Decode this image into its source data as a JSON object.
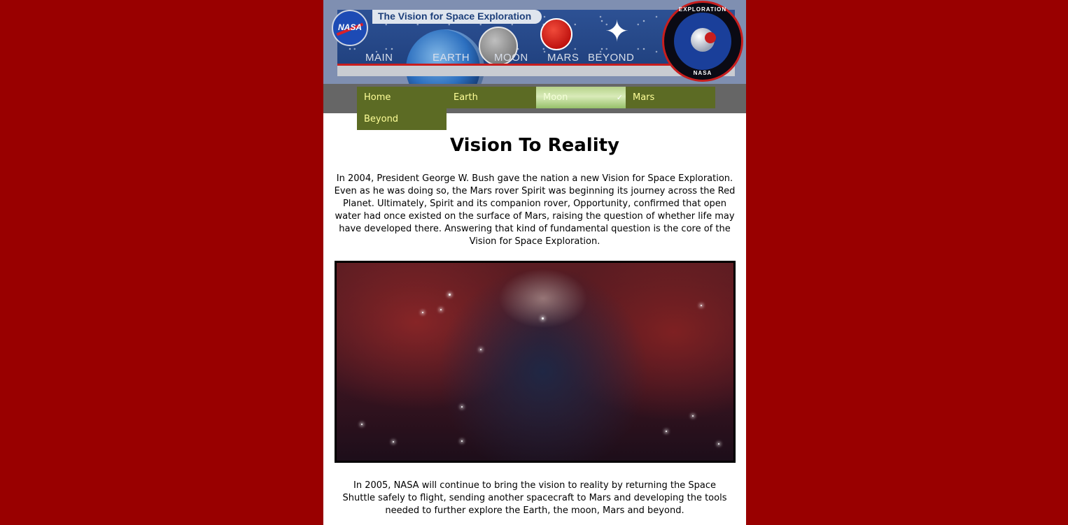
{
  "banner": {
    "title": "The Vision for Space Exploration",
    "logo_text": "NASA",
    "nav": [
      "MAIN",
      "EARTH",
      "MOON",
      "MARS",
      "BEYOND"
    ],
    "seal_top": "EXPLORATION",
    "seal_bottom": "NASA"
  },
  "nav": {
    "home": "Home",
    "earth": "Earth",
    "moon": "Moon",
    "mars": "Mars",
    "beyond": "Beyond"
  },
  "content": {
    "title": "Vision To Reality",
    "para_1": "In 2004, President George W. Bush gave the nation a new Vision for Space Exploration. Even as he was doing so, the Mars rover Spirit was beginning its journey across the Red Planet. Ultimately, Spirit and its companion rover, Opportunity, confirmed that open water had once existed on the surface of Mars, raising the question of whether life may have developed there. Answering that kind of fundamental question is the core of the Vision for Space Exploration.",
    "para_2": "In 2005, NASA will continue to bring the vision to reality by returning the Space Shuttle safely to flight, sending another spacecraft to Mars and developing the tools needed to further explore the Earth, the moon, Mars and beyond."
  },
  "colors": {
    "page_background": "#990000",
    "nav_item": "#5c6b24",
    "nav_text": "#ffff99",
    "nav_bar": "#666666"
  }
}
